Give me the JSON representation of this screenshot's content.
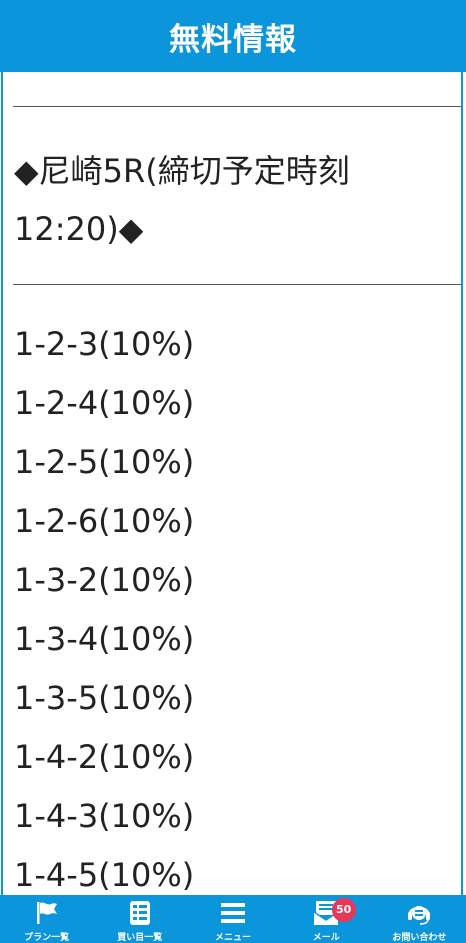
{
  "header": {
    "title": "無料情報"
  },
  "race": {
    "heading": "◆尼崎5R(締切予定時刻12:20)◆"
  },
  "picks": [
    "1-2-3(10%)",
    "1-2-4(10%)",
    "1-2-5(10%)",
    "1-2-6(10%)",
    "1-3-2(10%)",
    "1-3-4(10%)",
    "1-3-5(10%)",
    "1-4-2(10%)",
    "1-4-3(10%)",
    "1-4-5(10%)"
  ],
  "tabbar": {
    "plans": {
      "label": "プラン一覧",
      "icon": "flag-icon"
    },
    "bets": {
      "label": "買い目一覧",
      "icon": "list-icon"
    },
    "menu": {
      "label": "メニュー",
      "icon": "menu-icon"
    },
    "mail": {
      "label": "メール",
      "icon": "mail-icon",
      "badge": "50"
    },
    "contact": {
      "label": "お問い合わせ",
      "icon": "headset-icon"
    }
  },
  "colors": {
    "brand": "#0b95db",
    "badge": "#e8385a",
    "text": "#222222"
  }
}
